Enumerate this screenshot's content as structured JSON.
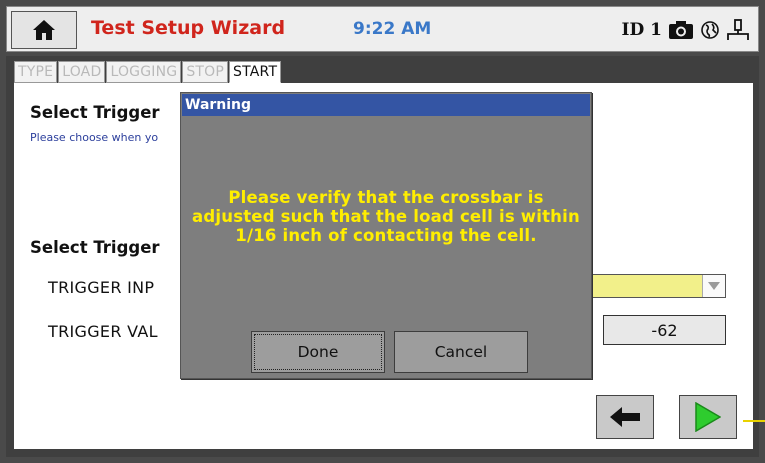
{
  "header": {
    "home_icon": "home-icon",
    "title": "Test Setup Wizard",
    "time": "9:22 AM",
    "device_id": "ID 1",
    "camera_icon": "camera-icon",
    "network_icon": "globe-icon",
    "usb_icon": "connection-icon"
  },
  "tabs": [
    "TYPE",
    "LOAD",
    "LOGGING",
    "STOP",
    "START"
  ],
  "active_tab": "START",
  "content": {
    "section1_title": "Select Trigger",
    "section1_subtitle": "Please choose when yo",
    "section2_title": "Select Trigger",
    "trigger_input_label": "TRIGGER INP",
    "trigger_value_label": "TRIGGER VAL",
    "trigger_input_value": "",
    "trigger_value": "-62"
  },
  "navigation": {
    "back_icon": "arrow-left-icon",
    "next_icon": "play-icon"
  },
  "dialog": {
    "title": "Warning",
    "message": "Please verify that the crossbar is adjusted such that the load cell is within 1/16 inch of contacting the cell.",
    "done_label": "Done",
    "cancel_label": "Cancel"
  },
  "colors": {
    "title_red": "#d0251c",
    "clock_blue": "#3a78c8",
    "dialog_title_bg": "#3455a4",
    "dialog_message": "#ffee00",
    "dropdown_fill": "#f2f08a",
    "play_green": "#2ecc2e",
    "callout": "#e9d200"
  }
}
